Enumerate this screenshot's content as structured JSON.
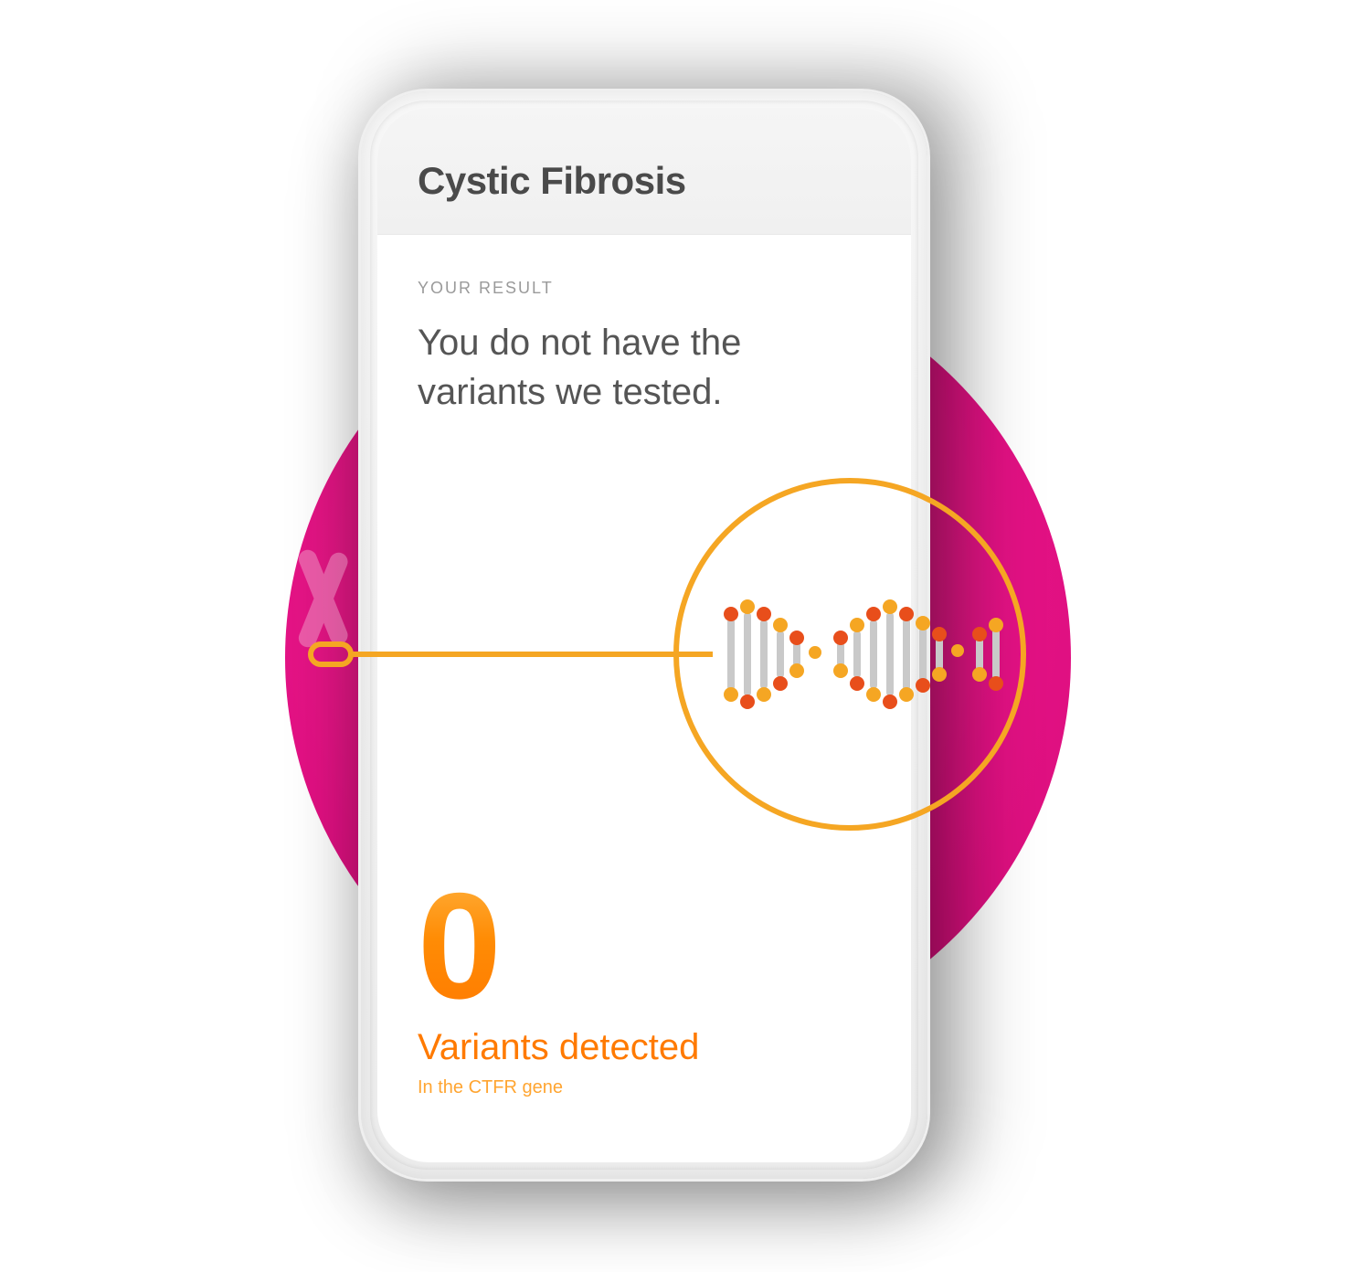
{
  "header": {
    "title": "Cystic Fibrosis"
  },
  "result": {
    "eyebrow": "YOUR RESULT",
    "summary": "You do not have the variants we tested.",
    "count": "0",
    "variants_label": "Variants detected",
    "gene_label": "In the CTFR gene"
  },
  "colors": {
    "accent_pink": "#e31184",
    "accent_orange": "#ff7a00",
    "accent_amber": "#ffa531"
  }
}
